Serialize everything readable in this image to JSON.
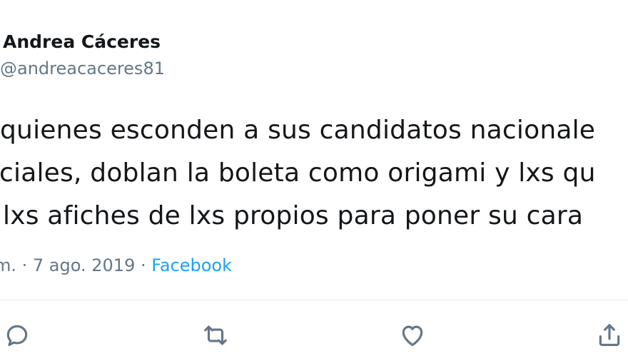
{
  "tweet": {
    "author": {
      "display_name": "Andrea Cáceres",
      "handle": "@andreacaceres81"
    },
    "text_lines": [
      "quienes esconden a sus candidatos nacionale",
      "nciales, doblan la boleta como origami y lxs qu",
      "lxs afiches de lxs propios para poner su cara"
    ],
    "meta": {
      "time_fragment": "m. · 7 ago. 2019 · ",
      "source": "Facebook"
    },
    "actions": {
      "reply_icon": "reply-icon",
      "retweet_icon": "retweet-icon",
      "like_icon": "heart-icon",
      "share_icon": "share-icon"
    },
    "colors": {
      "text": "#14171a",
      "muted": "#657786",
      "link": "#1da1f2",
      "divider": "#e6ecf0"
    }
  }
}
